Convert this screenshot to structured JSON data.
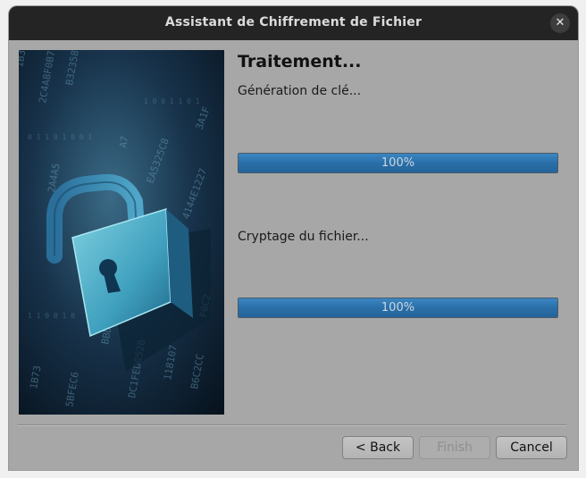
{
  "window": {
    "title": "Assistant de Chiffrement de Fichier",
    "close_icon": "close-icon"
  },
  "page": {
    "heading": "Traitement...",
    "key_label": "Génération de clé...",
    "key_progress_text": "100%",
    "key_progress_value": 100,
    "encrypt_label": "Cryptage du fichier...",
    "encrypt_progress_text": "100%",
    "encrypt_progress_value": 100
  },
  "buttons": {
    "back": "< Back",
    "finish": "Finish",
    "cancel": "Cancel"
  },
  "colors": {
    "progress_fill": "#2a6fa8",
    "titlebar": "#242424",
    "window_bg": "#a7a7a7"
  }
}
